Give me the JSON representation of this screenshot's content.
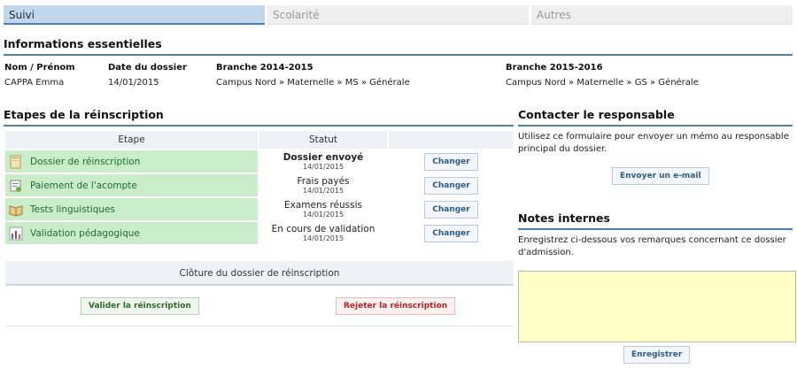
{
  "tabs": [
    {
      "label": "Suivi",
      "active": true
    },
    {
      "label": "Scolarité",
      "active": false
    },
    {
      "label": "Autres",
      "active": false
    }
  ],
  "info": {
    "title": "Informations essentielles",
    "fields": [
      {
        "label": "Nom / Prénom",
        "value": "CAPPA Emma"
      },
      {
        "label": "Date du dossier",
        "value": "14/01/2015"
      },
      {
        "label": "Branche 2014-2015",
        "value": "Campus Nord » Maternelle » MS » Générale"
      },
      {
        "label": "Branche 2015-2016",
        "value": "Campus Nord » Maternelle » GS » Générale"
      }
    ]
  },
  "steps": {
    "title": "Etapes de la réinscription",
    "headers": {
      "step": "Etape",
      "status": "Statut"
    },
    "change_label": "Changer",
    "rows": [
      {
        "icon": "folder-icon",
        "label": "Dossier de réinscription",
        "status": "Dossier envoyé",
        "date": "14/01/2015",
        "bold": true
      },
      {
        "icon": "payment-icon",
        "label": "Paiement de l'acompte",
        "status": "Frais payés",
        "date": "14/01/2015",
        "bold": false
      },
      {
        "icon": "book-icon",
        "label": "Tests linguistiques",
        "status": "Examens réussis",
        "date": "14/01/2015",
        "bold": false
      },
      {
        "icon": "chart-icon",
        "label": "Validation pédagogique",
        "status": "En cours de validation",
        "date": "14/01/2015",
        "bold": false
      }
    ]
  },
  "closure": {
    "title": "Clôture du dossier de réinscription",
    "validate_label": "Valider la réinscription",
    "reject_label": "Rejeter la réinscription"
  },
  "contact": {
    "title": "Contacter le responsable",
    "text_line1": "Utilisez ce formulaire pour envoyer un mémo au responsable",
    "text_line2": "principal du dossier.",
    "button": "Envoyer un e-mail"
  },
  "notes": {
    "title": "Notes internes",
    "text_line1": "Enregistrez ci-dessous vos remarques concernant ce dossier",
    "text_line2": "d'admission.",
    "value": "",
    "button": "Enregistrer"
  },
  "colors": {
    "accent": "#4a7fc0",
    "step_bg": "#c9ecc9",
    "notes_bg": "#ffffc6"
  }
}
